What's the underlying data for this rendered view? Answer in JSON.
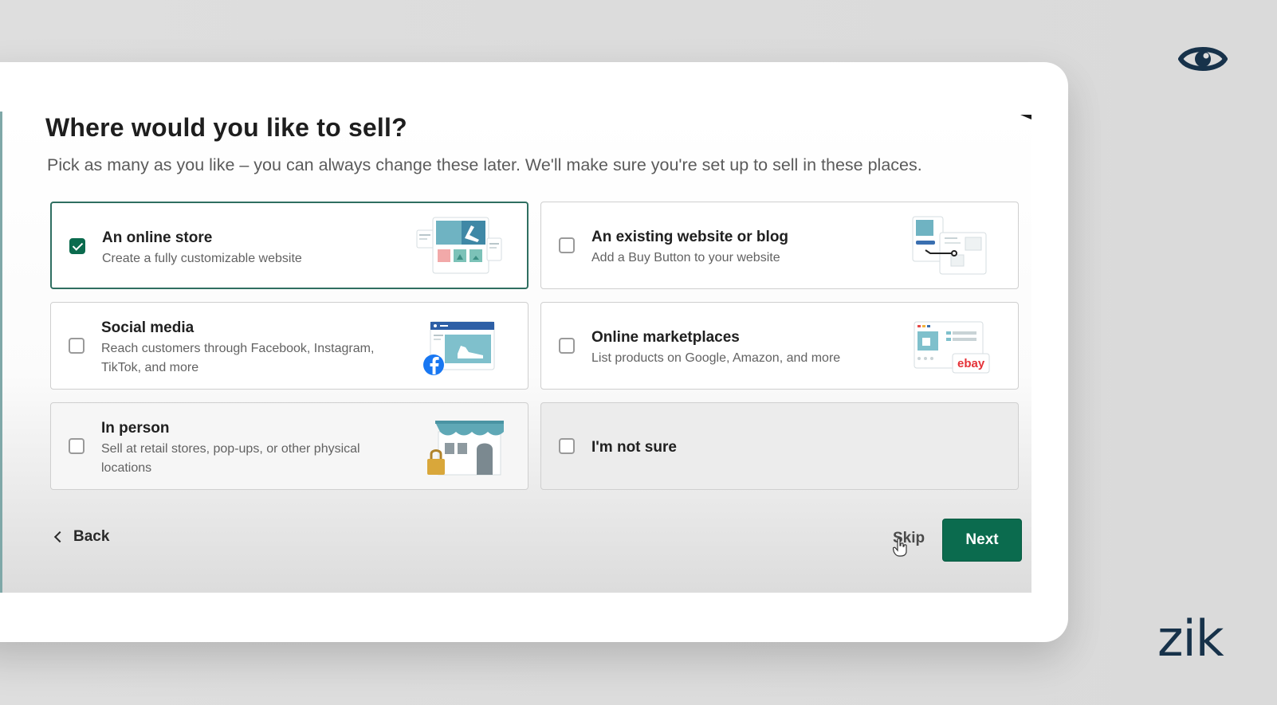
{
  "page": {
    "title": "Where would you like to sell?",
    "subtitle": "Pick as many as you like – you can always change these later. We'll make sure you're set up to sell in these places."
  },
  "options": [
    {
      "title": "An online store",
      "desc": "Create a fully customizable website",
      "checked": true,
      "illustration": "online-store-illustration"
    },
    {
      "title": "An existing website or blog",
      "desc": "Add a Buy Button to your website",
      "checked": false,
      "illustration": "website-blog-illustration"
    },
    {
      "title": "Social media",
      "desc": "Reach customers through Facebook, Instagram, TikTok, and more",
      "checked": false,
      "illustration": "social-media-illustration"
    },
    {
      "title": "Online marketplaces",
      "desc": "List products on Google, Amazon, and more",
      "checked": false,
      "illustration": "marketplaces-illustration",
      "badge": "ebay"
    },
    {
      "title": "In person",
      "desc": "Sell at retail stores, pop-ups, or other physical locations",
      "checked": false,
      "illustration": "storefront-illustration"
    },
    {
      "title": "I'm not sure",
      "desc": "",
      "checked": false
    }
  ],
  "footer": {
    "back_label": "Back",
    "skip_label": "Skip",
    "next_label": "Next"
  },
  "overlay": {
    "brand": "zik",
    "eye_icon": "eye-icon"
  },
  "colors": {
    "accent": "#0b6b4e",
    "brand": "#17324a",
    "selected_border": "#2f6f61"
  }
}
